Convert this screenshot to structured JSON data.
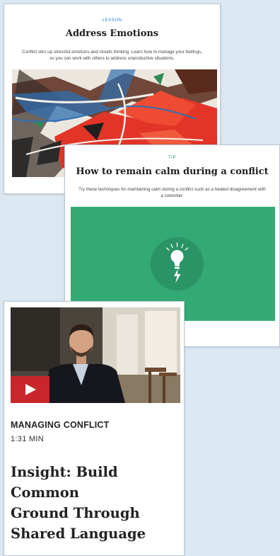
{
  "lesson_card": {
    "tag": "LESSON",
    "title": "Address Emotions",
    "description": "Conflict stirs up stressful emotions and clouds thinking. Learn how to manage your feelings, so you can work with others to address unproductive situations."
  },
  "tip_card": {
    "tag": "TIP",
    "title": "How to remain calm during a conflict",
    "description": "Try these techniques for maintaining calm during a conflict such as a heated disagreement with a coworker.",
    "icon": "lightbulb-icon",
    "hero_color": "#33a974"
  },
  "video_card": {
    "category": "MANAGING CONFLICT",
    "duration": "1:31 MIN",
    "title_lines": [
      "Insight: Build Common",
      "Ground Through",
      "Shared Language"
    ],
    "play_color": "#c8262b"
  }
}
